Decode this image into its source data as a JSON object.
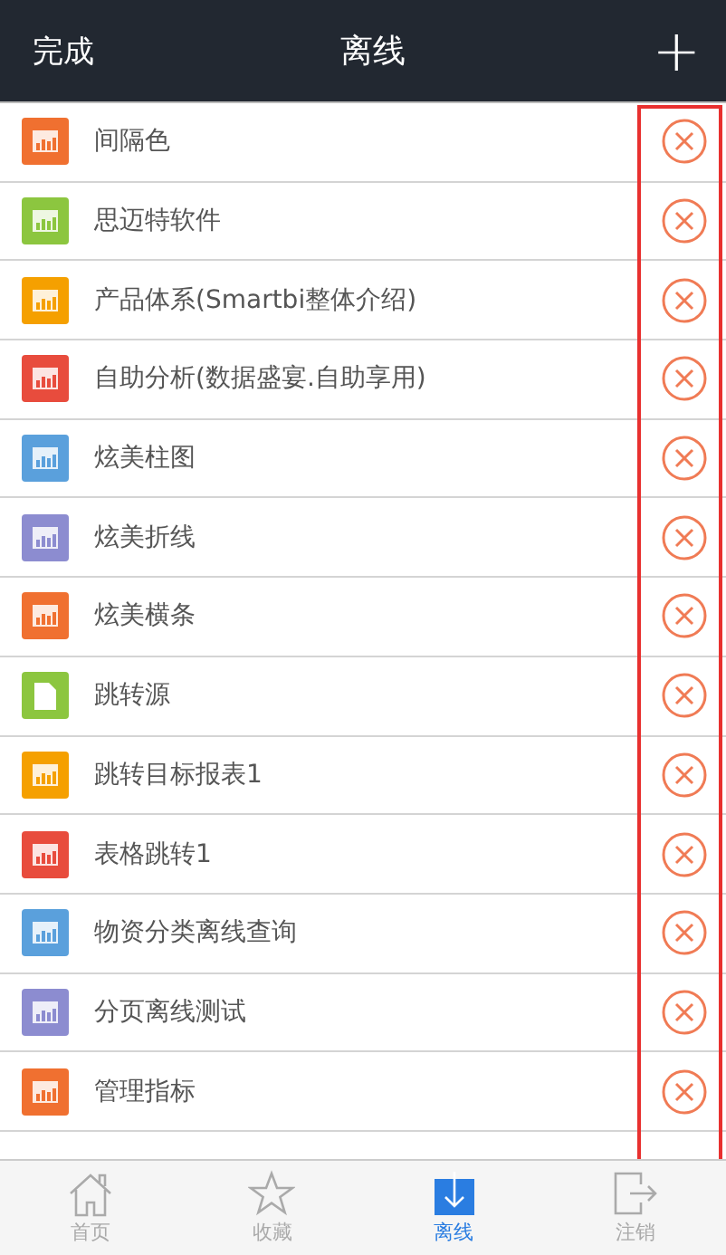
{
  "header": {
    "done": "完成",
    "title": "离线",
    "add": "+"
  },
  "items": [
    {
      "name": "间隔色",
      "kind": "chart",
      "color": "#f07030"
    },
    {
      "name": "思迈特软件",
      "kind": "chart",
      "color": "#8cc63f"
    },
    {
      "name": "产品体系(Smartbi整体介绍)",
      "kind": "chart",
      "color": "#f5a000"
    },
    {
      "name": "自助分析(数据盛宴.自助享用)",
      "kind": "chart",
      "color": "#e84c3d"
    },
    {
      "name": "炫美柱图",
      "kind": "chart",
      "color": "#5aa0dc"
    },
    {
      "name": "炫美折线",
      "kind": "chart",
      "color": "#8c8cd0"
    },
    {
      "name": "炫美横条",
      "kind": "chart",
      "color": "#f07030"
    },
    {
      "name": "跳转源",
      "kind": "doc",
      "color": "#8cc63f"
    },
    {
      "name": "跳转目标报表1",
      "kind": "chart",
      "color": "#f5a000"
    },
    {
      "name": "表格跳转1",
      "kind": "chart",
      "color": "#e84c3d"
    },
    {
      "name": "物资分类离线查询",
      "kind": "chart",
      "color": "#5aa0dc"
    },
    {
      "name": "分页离线测试",
      "kind": "chart",
      "color": "#8c8cd0"
    },
    {
      "name": "管理指标",
      "kind": "chart",
      "color": "#f07030"
    }
  ],
  "tabs": [
    {
      "label": "首页",
      "kind": "home",
      "selected": false
    },
    {
      "label": "收藏",
      "kind": "star",
      "selected": false
    },
    {
      "label": "离线",
      "kind": "download",
      "selected": true
    },
    {
      "label": "注销",
      "kind": "logout",
      "selected": false
    }
  ]
}
